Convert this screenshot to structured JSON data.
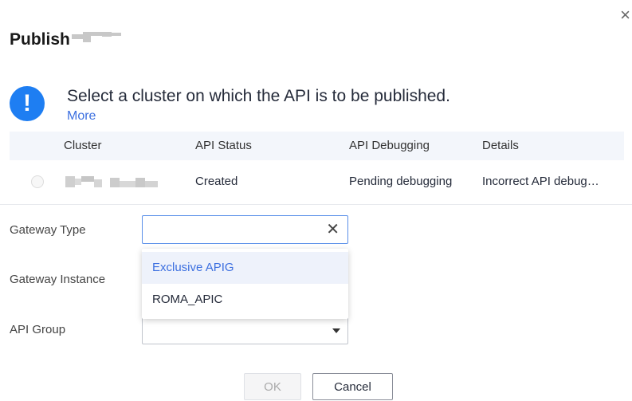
{
  "dialog": {
    "title": "Publish",
    "close_label": "×"
  },
  "notice": {
    "icon": "exclamation-icon",
    "icon_glyph": "!",
    "text": "Select a cluster on which the API is to be published.",
    "more": "More"
  },
  "table": {
    "columns": [
      "Cluster",
      "API Status",
      "API Debugging",
      "Details"
    ],
    "rows": [
      {
        "cluster": "",
        "status": "Created",
        "debugging": "Pending debugging",
        "details": "Incorrect API debug…"
      }
    ]
  },
  "form": {
    "gateway_type": {
      "label": "Gateway Type",
      "value": "",
      "clear": "✕"
    },
    "gateway_type_options": [
      "Exclusive APIG",
      "ROMA_APIC"
    ],
    "gateway_instance": {
      "label": "Gateway Instance"
    },
    "api_group": {
      "label": "API Group",
      "value": ""
    }
  },
  "buttons": {
    "ok": "OK",
    "cancel": "Cancel"
  },
  "colors": {
    "accent": "#1e7ef2",
    "link": "#3d70e0",
    "header_bg": "#f3f6fb"
  }
}
